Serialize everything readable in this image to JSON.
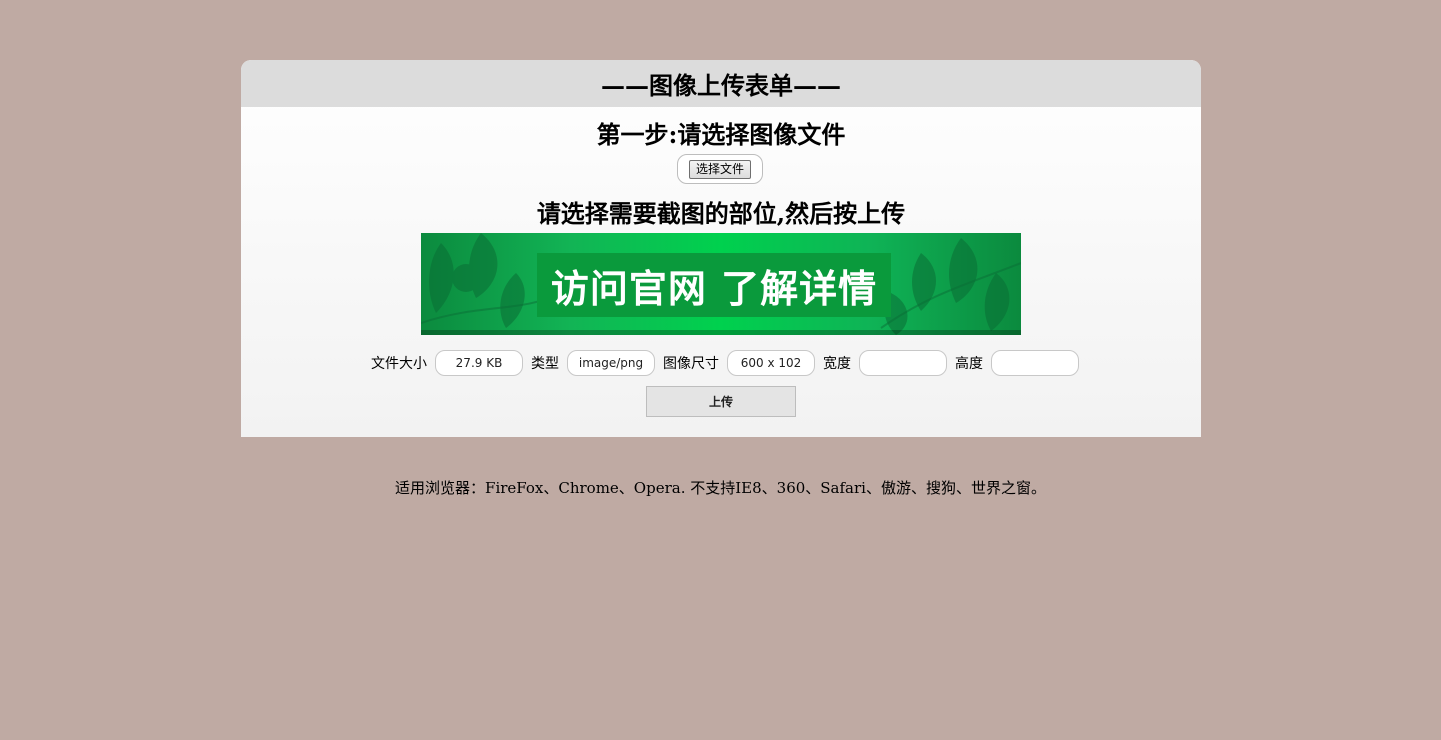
{
  "panel": {
    "header_title": "——图像上传表单——",
    "step_title": "第一步:请选择图像文件",
    "file_button_label": "选择文件",
    "instruction": "请选择需要截图的部位,然后按上传",
    "banner_text": "访问官网 了解详情"
  },
  "info": {
    "file_size_label": "文件大小",
    "file_size_value": "27.9 KB",
    "type_label": "类型",
    "type_value": "image/png",
    "dimensions_label": "图像尺寸",
    "dimensions_value": "600 x 102",
    "width_label": "宽度",
    "width_value": "",
    "height_label": "高度",
    "height_value": ""
  },
  "upload_button_label": "上传",
  "footer_text": "适用浏览器：FireFox、Chrome、Opera. 不支持IE8、360、Safari、傲游、搜狗、世界之窗。",
  "colors": {
    "page_background": "#bfaaa3",
    "header_background": "#dcdcdc",
    "banner_green": "#00d14e"
  },
  "icons": [
    "leaf-pattern-icon"
  ]
}
